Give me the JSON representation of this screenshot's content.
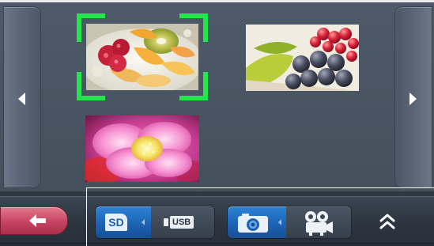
{
  "gallery": {
    "nav_left_icon": "chevron-left-icon",
    "nav_right_icon": "chevron-right-icon",
    "thumbnails": [
      {
        "name": "fruit-dessert",
        "selected": true
      },
      {
        "name": "grapes-and-berries",
        "selected": false
      },
      {
        "name": "pink-flower",
        "selected": false
      }
    ],
    "selection_color": "#22e64a"
  },
  "toolbar": {
    "back_icon": "back-arrow-icon",
    "back_color": "#c64462",
    "storage": {
      "sd_label": "SD",
      "usb_label": "USB",
      "selected": "SD"
    },
    "media": {
      "photo_icon": "camera-icon",
      "video_icon": "video-camera-icon",
      "selected": "photo"
    },
    "collapse_icon": "double-chevron-up-icon",
    "accent_color": "#1d64b5"
  }
}
